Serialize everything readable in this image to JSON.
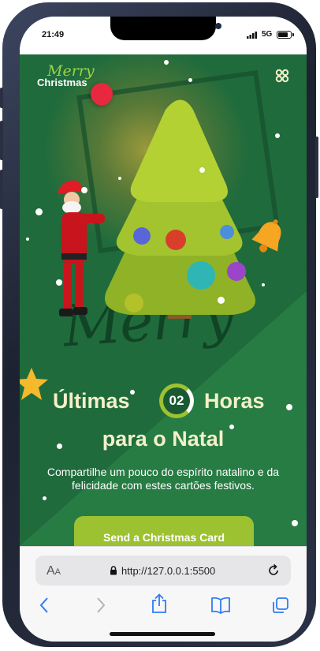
{
  "status_bar": {
    "time": "21:49",
    "network": "5G"
  },
  "header": {
    "logo_script": "Merry",
    "logo_text": "Christmas",
    "menu_icon": "grid-icon"
  },
  "hero": {
    "decor_script": "Merry",
    "title_part1": "Últimas",
    "countdown_value": "02",
    "title_part2": "Horas",
    "title_line2": "para o Natal",
    "subtitle": "Compartilhe um pouco do espírito natalino e da felicidade com estes cartões festivos.",
    "cta_label": "Send a Christmas Card"
  },
  "browser": {
    "text_size_label_big": "A",
    "text_size_label_small": "A",
    "url": "http://127.0.0.1:5500",
    "toolbar_icons": [
      "back-icon",
      "forward-icon",
      "share-icon",
      "bookmarks-icon",
      "tabs-icon"
    ]
  },
  "colors": {
    "accent": "#9dc231",
    "background": "#1f6b3c",
    "title": "#f3f0c9"
  }
}
